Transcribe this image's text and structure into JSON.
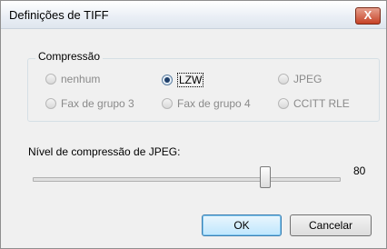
{
  "dialog": {
    "title": "Definições de TIFF",
    "close_label": "X"
  },
  "compression": {
    "legend": "Compressão",
    "options": [
      {
        "label": "nenhum",
        "checked": false
      },
      {
        "label": "LZW",
        "checked": true
      },
      {
        "label": "JPEG",
        "checked": false
      },
      {
        "label": "Fax de grupo 3",
        "checked": false
      },
      {
        "label": "Fax de grupo 4",
        "checked": false
      },
      {
        "label": "CCITT RLE",
        "checked": false
      }
    ]
  },
  "jpeg_level": {
    "label": "Nível de compressão de JPEG:",
    "value": "80"
  },
  "buttons": {
    "ok": "OK",
    "cancel": "Cancelar"
  }
}
